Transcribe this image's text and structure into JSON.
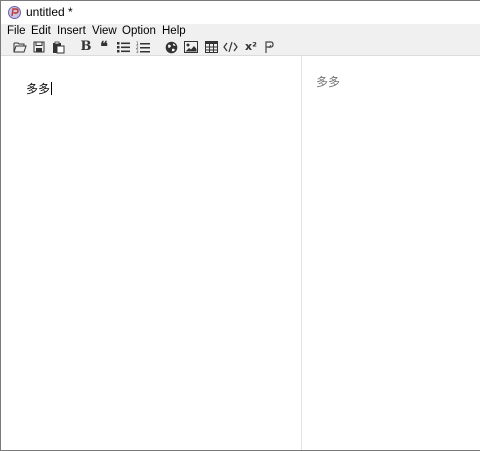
{
  "window": {
    "title": "untitled *"
  },
  "menu": {
    "file": "File",
    "edit": "Edit",
    "insert": "Insert",
    "view": "View",
    "option": "Option",
    "help": "Help"
  },
  "toolbar": {
    "bold_glyph": "B",
    "quote_glyph": "❝",
    "superscript_glyph": "x²",
    "icons": [
      "folder-open-icon",
      "save-icon",
      "paste-icon",
      "bold-icon",
      "quote-icon",
      "unordered-list-icon",
      "ordered-list-icon",
      "link-globe-icon",
      "image-icon",
      "table-icon",
      "code-icon",
      "superscript-icon",
      "paragraph-icon"
    ]
  },
  "editor": {
    "content": "多多"
  },
  "preview": {
    "content": "多多"
  }
}
